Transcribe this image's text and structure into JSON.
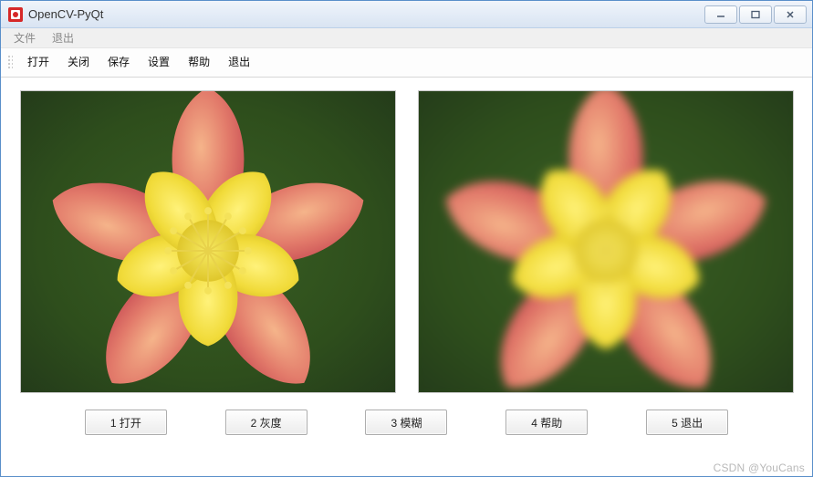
{
  "window": {
    "title": "OpenCV-PyQt",
    "controls": {
      "minimize": "minimize",
      "maximize": "maximize",
      "close": "close"
    }
  },
  "menubar": {
    "items": [
      "文件",
      "退出"
    ]
  },
  "toolbar": {
    "items": [
      "打开",
      "关闭",
      "保存",
      "设置",
      "帮助",
      "退出"
    ]
  },
  "images": {
    "left_label": "original-image",
    "right_label": "processed-image",
    "subject": "yellow-columbine-flower",
    "processing_applied": "blur"
  },
  "buttons": {
    "items": [
      {
        "id": "open",
        "label": "1 打开"
      },
      {
        "id": "gray",
        "label": "2 灰度"
      },
      {
        "id": "blur",
        "label": "3 模糊"
      },
      {
        "id": "help",
        "label": "4 帮助"
      },
      {
        "id": "exit",
        "label": "5 退出"
      }
    ]
  },
  "watermark": "CSDN @YouCans"
}
